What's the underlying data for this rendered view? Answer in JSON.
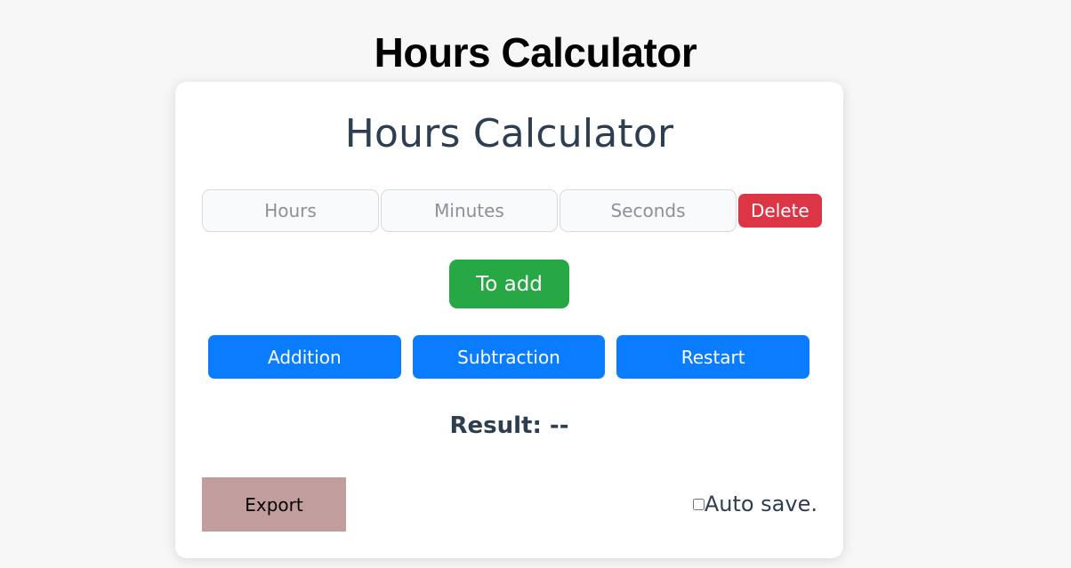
{
  "page": {
    "title": "Hours Calculator",
    "background_color": "#f7f7f7"
  },
  "card": {
    "heading": "Hours Calculator",
    "background_color": "#ffffff",
    "inputs": [
      {
        "name": "hours",
        "placeholder": "Hours",
        "value": ""
      },
      {
        "name": "minutes",
        "placeholder": "Minutes",
        "value": ""
      },
      {
        "name": "seconds",
        "placeholder": "Seconds",
        "value": ""
      }
    ],
    "delete_button": {
      "label": "Delete",
      "color": "#dc3545"
    },
    "add_button": {
      "label": "To add",
      "color": "#28a745"
    },
    "operations": [
      {
        "name": "addition",
        "label": "Addition",
        "color": "#0a7cff"
      },
      {
        "name": "subtraction",
        "label": "Subtraction",
        "color": "#0a7cff"
      },
      {
        "name": "restart",
        "label": "Restart",
        "color": "#0a7cff"
      }
    ],
    "result": {
      "label": "Result: --",
      "value": "--"
    },
    "export_button": {
      "label": "Export",
      "color": "#c29d9d"
    },
    "autosave": {
      "label": "Auto save.",
      "checked": false
    }
  }
}
